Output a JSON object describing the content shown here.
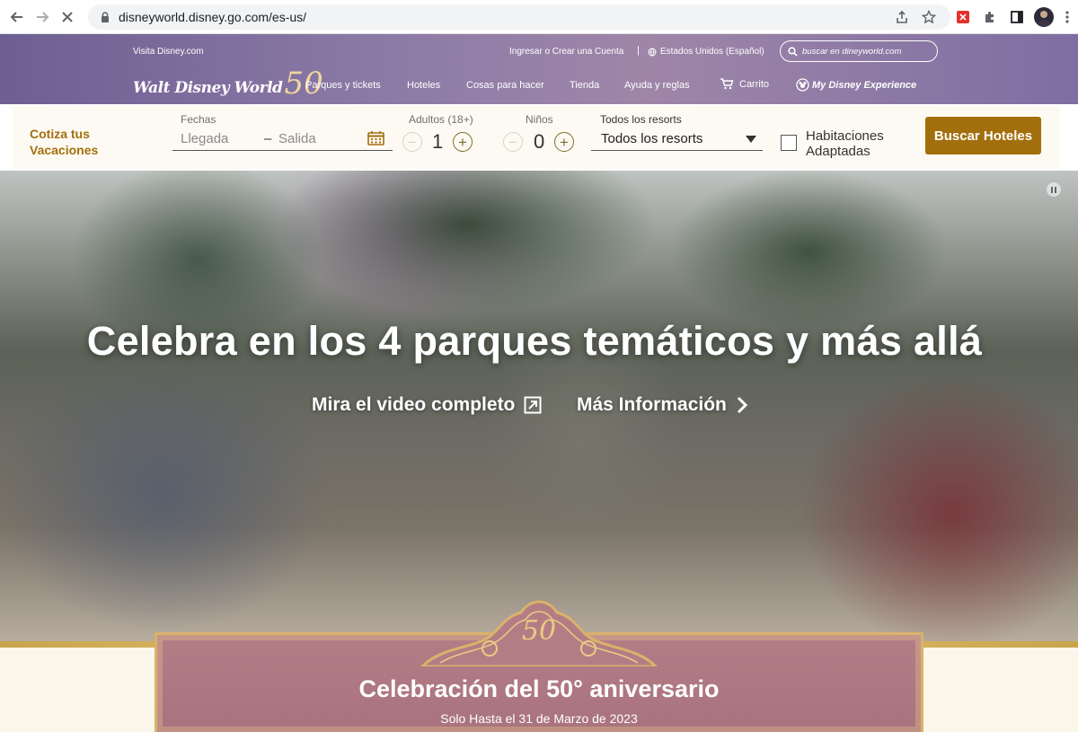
{
  "browser": {
    "url": "disneyworld.disney.go.com/es-us/"
  },
  "header": {
    "visita": "Visita Disney.com",
    "account": "Ingresar o Crear una Cuenta",
    "separator": "|",
    "country": "Estados Unidos (Español)",
    "search_placeholder": "buscar en dineyworld.com",
    "logo_text": "Walt Disney World",
    "logo_number": "50",
    "nav": [
      "Parques y tickets",
      "Hoteles",
      "Cosas para hacer",
      "Tienda",
      "Ayuda y reglas",
      "Carrito",
      "My Disney Experience"
    ]
  },
  "booking": {
    "title_line1": "Cotiza tus",
    "title_line2": "Vacaciones",
    "dates_label": "Fechas",
    "arrival_placeholder": "Llegada",
    "dash": "–",
    "departure_placeholder": "Salida",
    "adults_label": "Adultos (18+)",
    "adults_value": "1",
    "children_label": "Niños",
    "children_value": "0",
    "resorts_label": "Todos los resorts",
    "resorts_value": "Todos los resorts",
    "accessible_line1": "Habitaciones",
    "accessible_line2": "Adaptadas",
    "search_button": "Buscar Hoteles"
  },
  "hero": {
    "headline": "Celebra en los 4 parques temáticos y más allá",
    "video_link": "Mira el video completo",
    "more_link": "Más Información"
  },
  "promo": {
    "title": "Celebración del 50° aniversario",
    "subtitle": "Solo Hasta el 31 de Marzo de 2023"
  },
  "colors": {
    "brand_gold": "#a36f0d",
    "header_purple": "#8b7aa6",
    "plaque_rose": "#b47d86"
  }
}
